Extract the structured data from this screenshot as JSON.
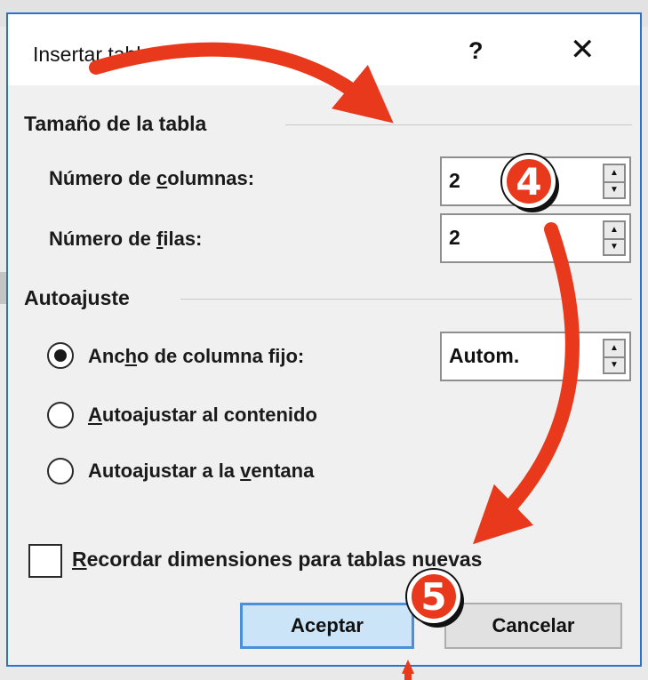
{
  "dialog": {
    "title": "Insertar tabla",
    "help_label": "?",
    "close_label": "✕"
  },
  "table_size": {
    "group_label": "Tamaño de la tabla",
    "columns": {
      "label_pre": "Número de ",
      "label_accel": "c",
      "label_post": "olumnas:",
      "value": "2"
    },
    "rows": {
      "label_pre": "Número de ",
      "label_accel": "f",
      "label_post": "ilas:",
      "value": "2"
    }
  },
  "autofit": {
    "group_label": "Autoajuste",
    "fixed": {
      "label_pre": "Anc",
      "label_accel": "h",
      "label_post": "o de columna fijo:",
      "value": "Autom.",
      "checked": true
    },
    "content": {
      "label_pre": "",
      "label_accel": "A",
      "label_post": "utoajustar al contenido",
      "checked": false
    },
    "window": {
      "label_pre": "Autoajustar a la ",
      "label_accel": "v",
      "label_post": "entana",
      "checked": false
    }
  },
  "remember": {
    "label_pre": "",
    "label_accel": "R",
    "label_post": "ecordar dimensiones para tablas nuevas",
    "checked": false
  },
  "buttons": {
    "accept": "Aceptar",
    "cancel": "Cancelar"
  },
  "annotations": {
    "step4": "4",
    "step5": "5",
    "arrow_color": "#e8391c"
  }
}
